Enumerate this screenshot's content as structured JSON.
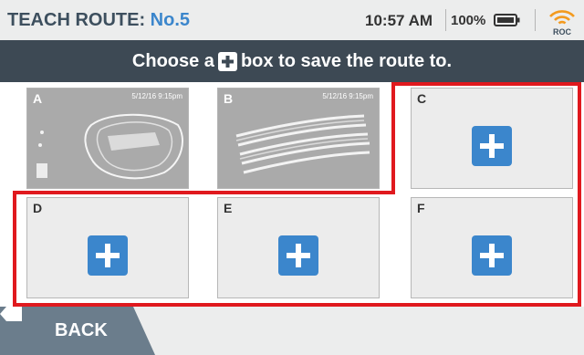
{
  "header": {
    "title_prefix": "TEACH ROUTE:",
    "route_number": "No.5",
    "time": "10:57 AM",
    "battery": "100%",
    "battery_icon": "battery-full-icon",
    "status_icon": "roc-wifi-icon",
    "status_icon_label": "ROC"
  },
  "banner": {
    "text_before": "Choose a",
    "icon": "plus-box-icon",
    "text_after": "box to save the route to."
  },
  "slots": [
    {
      "label": "A",
      "state": "saved",
      "timestamp": "5/12/16 9:15pm"
    },
    {
      "label": "B",
      "state": "saved",
      "timestamp": "5/12/16 9:15pm"
    },
    {
      "label": "C",
      "state": "empty",
      "icon": "plus-icon"
    },
    {
      "label": "D",
      "state": "empty",
      "icon": "plus-icon"
    },
    {
      "label": "E",
      "state": "empty",
      "icon": "plus-icon"
    },
    {
      "label": "F",
      "state": "empty",
      "icon": "plus-icon"
    }
  ],
  "footer": {
    "back_label": "BACK",
    "back_icon": "back-arrow-icon"
  },
  "colors": {
    "accent_blue": "#3b86cc",
    "header_text": "#3d4f5e",
    "banner_bg": "#3d4954",
    "highlight_red": "#e0191e",
    "back_bg": "#6b7d8c"
  }
}
